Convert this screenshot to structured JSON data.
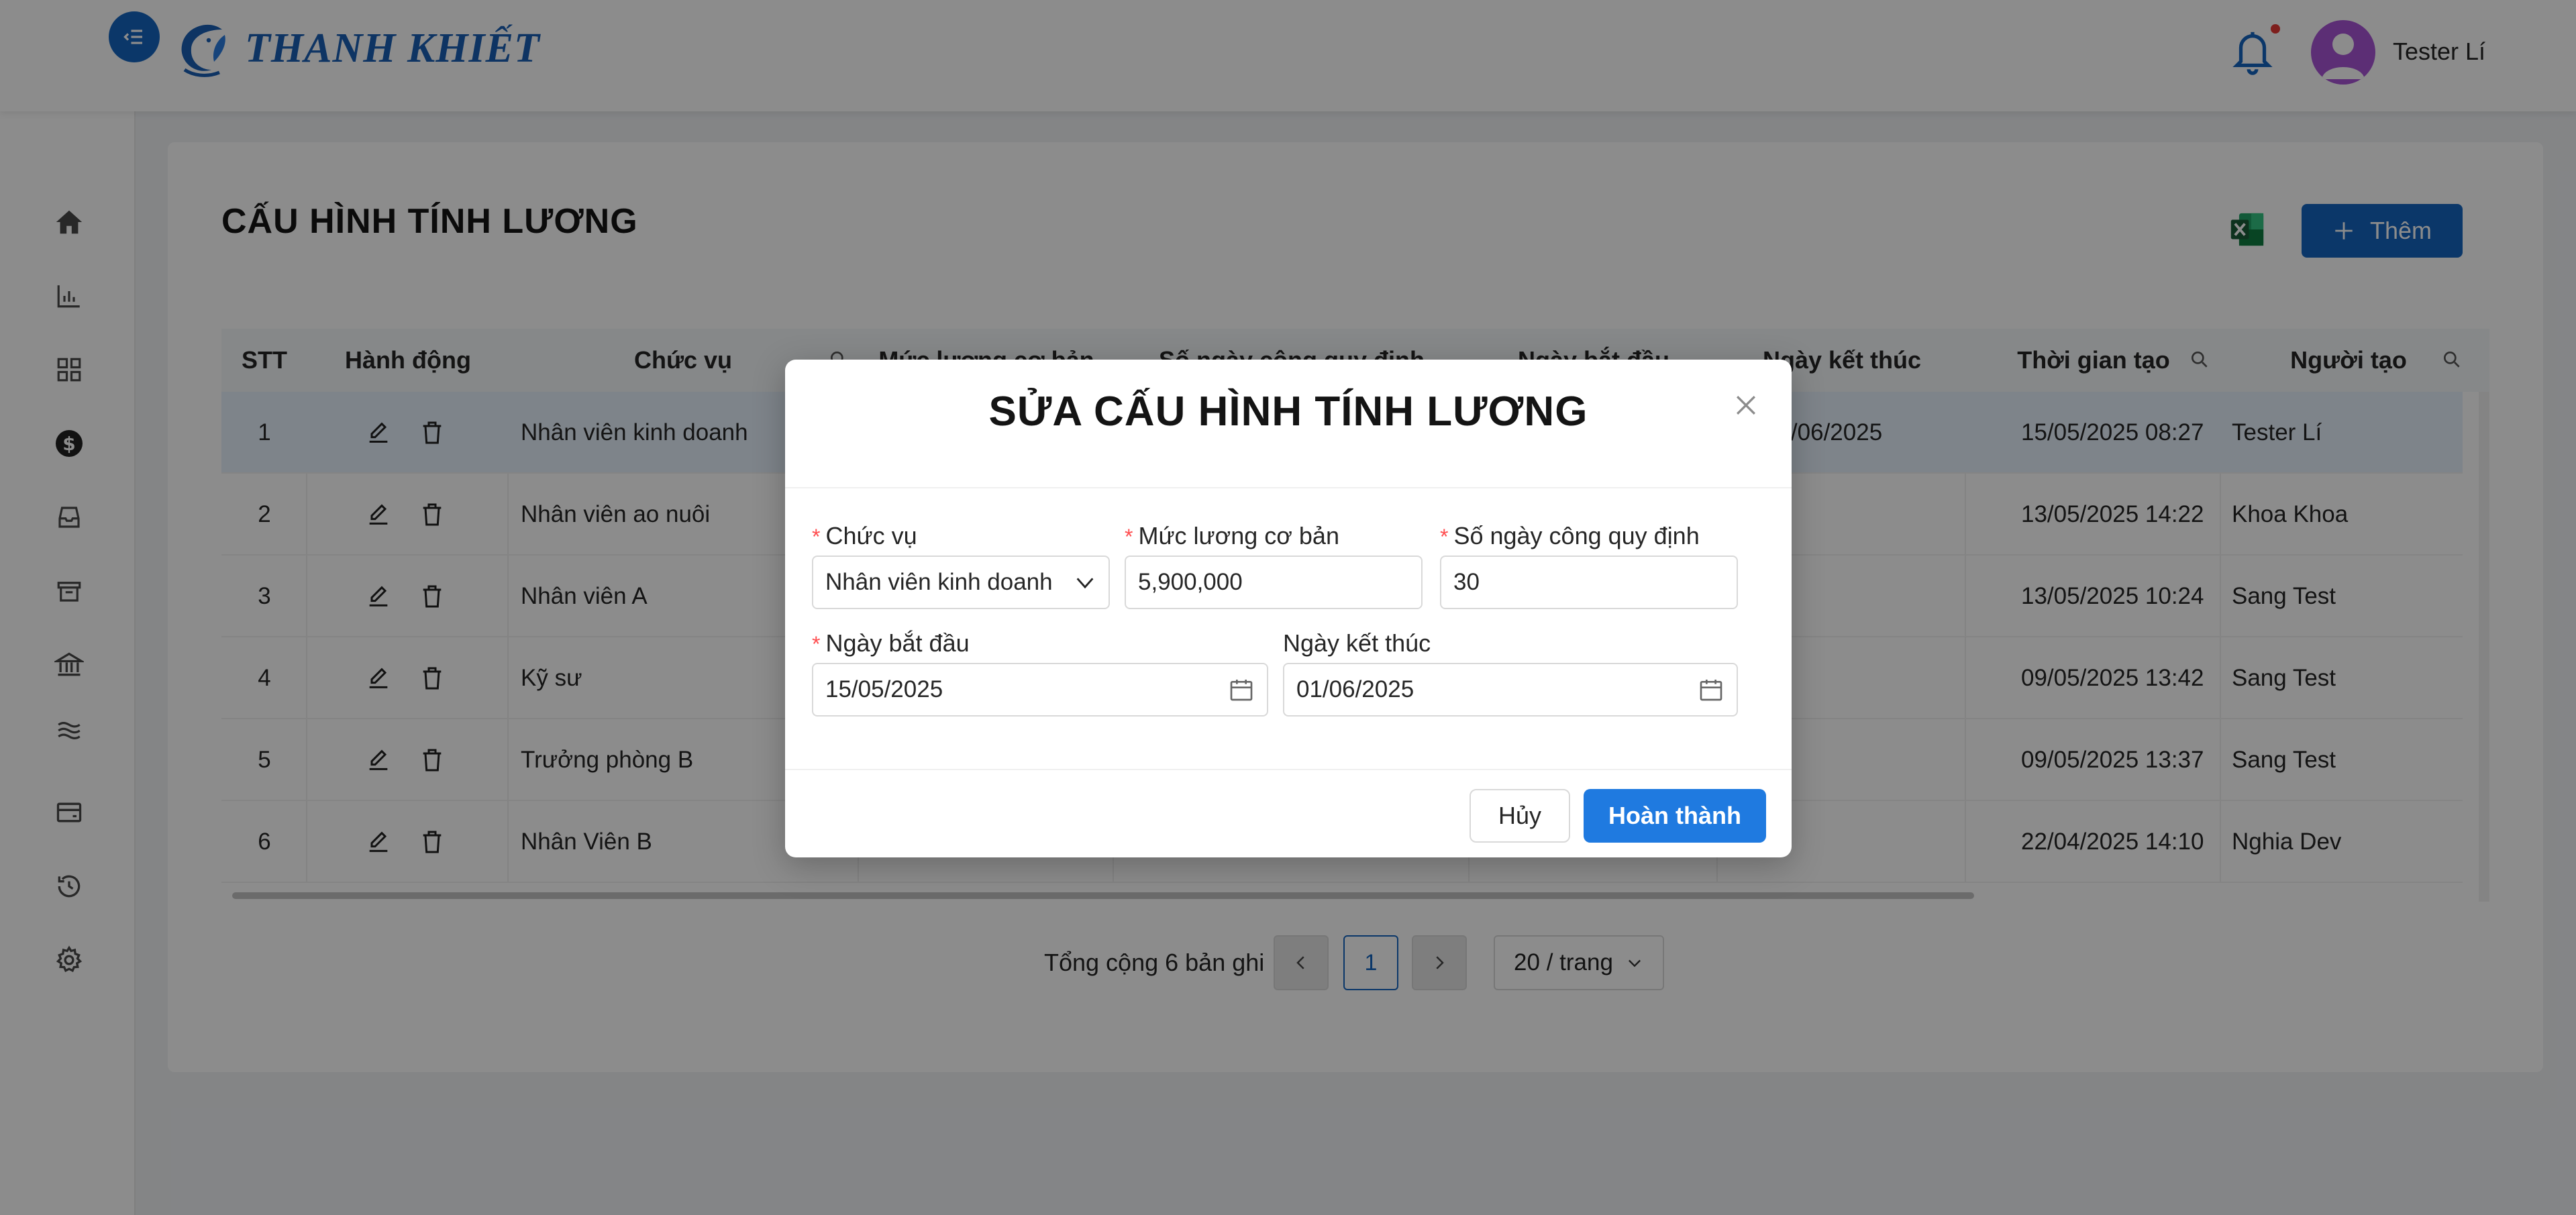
{
  "header": {
    "logo_text": "THANH KHIẾT",
    "user_name": "Tester Lí"
  },
  "sidebar": {
    "icons": [
      "home-icon",
      "bar-chart-icon",
      "grid-icon",
      "dollar-icon",
      "inbox-icon",
      "inventory-icon",
      "bank-icon",
      "waves-icon",
      "wallet-icon",
      "history-icon",
      "gear-icon"
    ],
    "active": "dollar-icon"
  },
  "page": {
    "title": "CẤU HÌNH TÍNH LƯƠNG",
    "add_label": "Thêm"
  },
  "table": {
    "headers": {
      "stt": "STT",
      "actions": "Hành động",
      "position": "Chức vụ",
      "salary": "Mức lương cơ bản",
      "days": "Số ngày công quy định",
      "start": "Ngày bắt đầu",
      "end": "Ngày kết thúc",
      "created_at": "Thời gian tạo",
      "creator": "Người tạo"
    },
    "rows": [
      {
        "stt": "1",
        "position": "Nhân viên kinh doanh",
        "end": "01/06/2025",
        "created_at": "15/05/2025 08:27",
        "creator": "Tester Lí"
      },
      {
        "stt": "2",
        "position": "Nhân viên ao nuôi",
        "end": "",
        "created_at": "13/05/2025 14:22",
        "creator": "Khoa Khoa"
      },
      {
        "stt": "3",
        "position": "Nhân viên A",
        "end": "",
        "created_at": "13/05/2025 10:24",
        "creator": "Sang Test"
      },
      {
        "stt": "4",
        "position": "Kỹ sư",
        "end": "",
        "created_at": "09/05/2025 13:42",
        "creator": "Sang Test"
      },
      {
        "stt": "5",
        "position": "Trưởng phòng B",
        "end": "",
        "created_at": "09/05/2025 13:37",
        "creator": "Sang Test"
      },
      {
        "stt": "6",
        "position": "Nhân Viên B",
        "end": "",
        "created_at": "22/04/2025 14:10",
        "creator": "Nghia Dev"
      }
    ]
  },
  "pagination": {
    "total_text": "Tổng cộng 6 bản ghi",
    "current_page": "1",
    "page_size": "20 / trang"
  },
  "modal": {
    "title": "SỬA CẤU HÌNH TÍNH LƯƠNG",
    "fields": {
      "position": {
        "label": "Chức vụ",
        "value": "Nhân viên kinh doanh"
      },
      "salary": {
        "label": "Mức lương cơ bản",
        "value": "5,900,000"
      },
      "days": {
        "label": "Số ngày công quy định",
        "value": "30"
      },
      "start": {
        "label": "Ngày bắt đầu",
        "value": "15/05/2025"
      },
      "end": {
        "label": "Ngày kết thúc",
        "value": "01/06/2025"
      }
    },
    "required_mark": "*",
    "cancel_label": "Hủy",
    "submit_label": "Hoàn thành"
  }
}
